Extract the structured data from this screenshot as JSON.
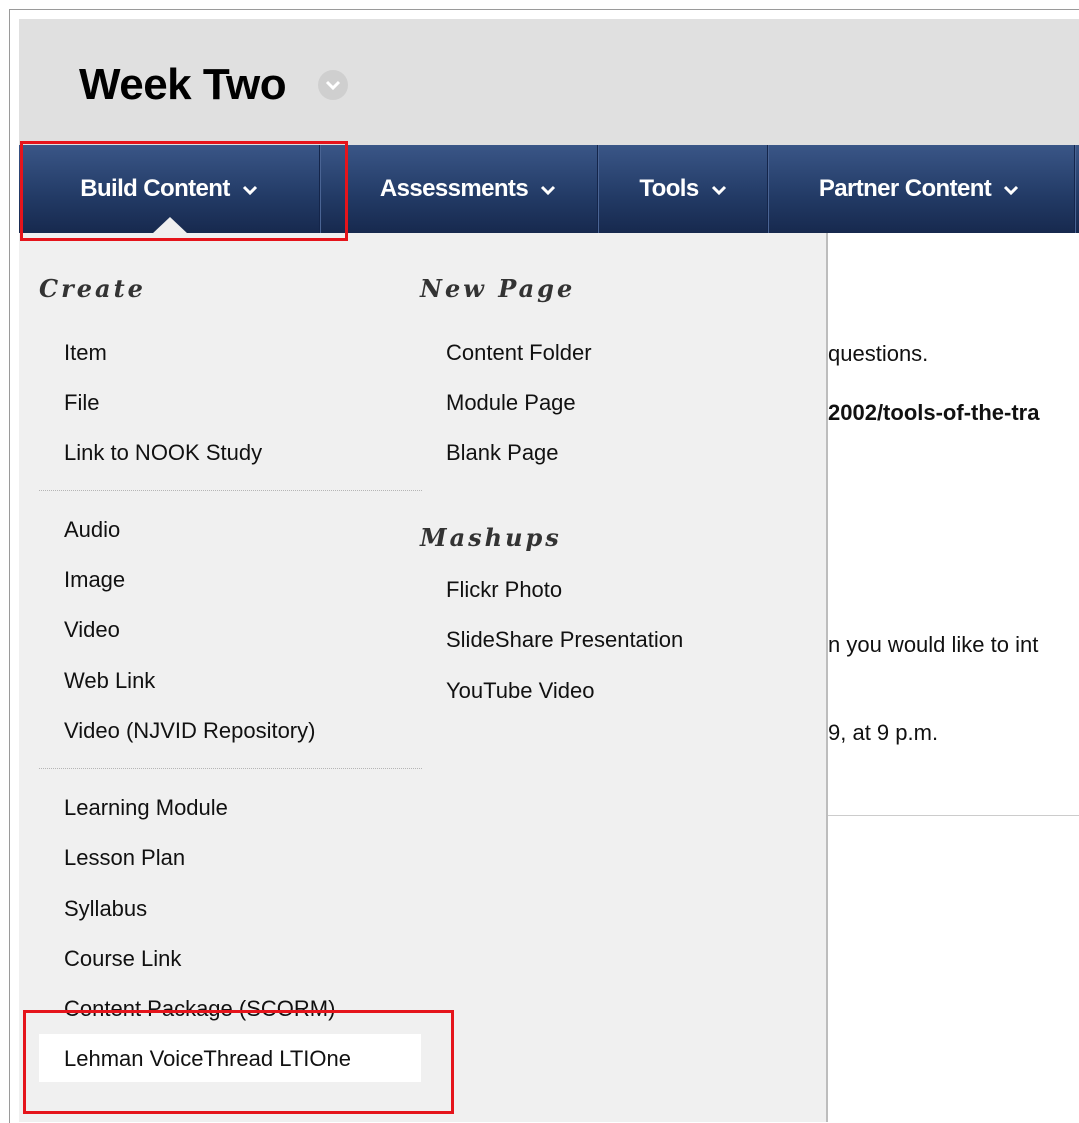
{
  "page": {
    "title": "Week Two"
  },
  "action_bar": {
    "tabs": [
      {
        "label": "Build Content"
      },
      {
        "label": "Assessments"
      },
      {
        "label": "Tools"
      },
      {
        "label": "Partner Content"
      }
    ]
  },
  "background_content": {
    "lines": [
      "questions.",
      "2002/tools-of-the-tra",
      "n you would like to int",
      "9, at 9 p.m."
    ]
  },
  "dropdown": {
    "create": {
      "heading": "Create",
      "group1": [
        "Item",
        "File",
        "Link to NOOK Study"
      ],
      "group2": [
        "Audio",
        "Image",
        "Video",
        "Web Link",
        "Video (NJVID Repository)"
      ],
      "group3": [
        "Learning Module",
        "Lesson Plan",
        "Syllabus",
        "Course Link",
        "Content Package (SCORM)",
        "Lehman VoiceThread LTIOne"
      ]
    },
    "new_page": {
      "heading": "New Page",
      "items": [
        "Content Folder",
        "Module Page",
        "Blank Page"
      ]
    },
    "mashups": {
      "heading": "Mashups",
      "items": [
        "Flickr Photo",
        "SlideShare Presentation",
        "YouTube Video"
      ]
    }
  },
  "colors": {
    "action_bar": "#223a65",
    "dropdown_bg": "#f0f0f0",
    "header_bg": "#e0e0e0",
    "callout": "#e5141b"
  }
}
